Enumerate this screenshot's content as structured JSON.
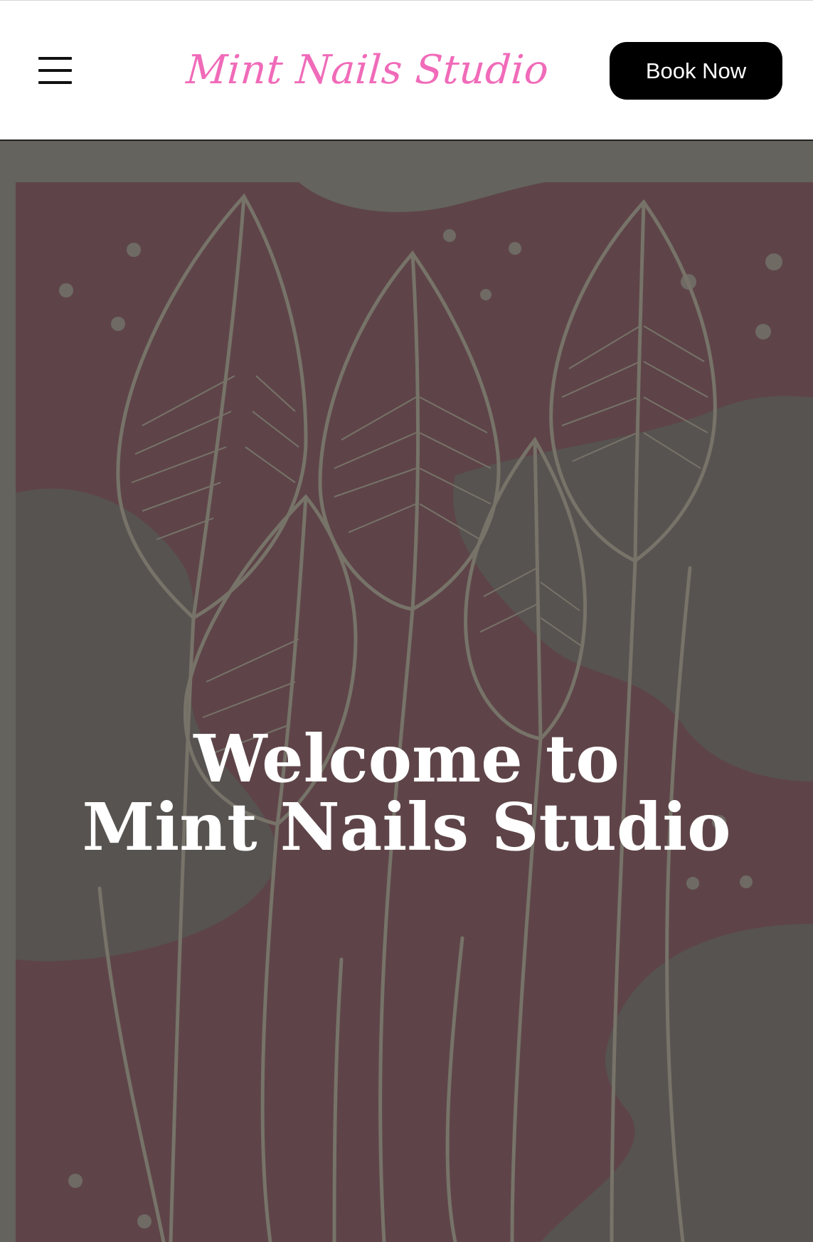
{
  "header": {
    "menu_icon": "hamburger-menu-icon",
    "logo_text": "Mint Nails Studio",
    "book_label": "Book Now"
  },
  "hero": {
    "title_line1": "Welcome to",
    "title_line2": "Mint Nails Studio",
    "background_illustration": "leaf-line-art"
  },
  "colors": {
    "brand_pink": "#f06bb9",
    "button_black": "#000000",
    "hero_frame": "#64635d",
    "hero_maroon": "#5e4448",
    "hero_gray": "#575350",
    "line_art": "#777369"
  }
}
